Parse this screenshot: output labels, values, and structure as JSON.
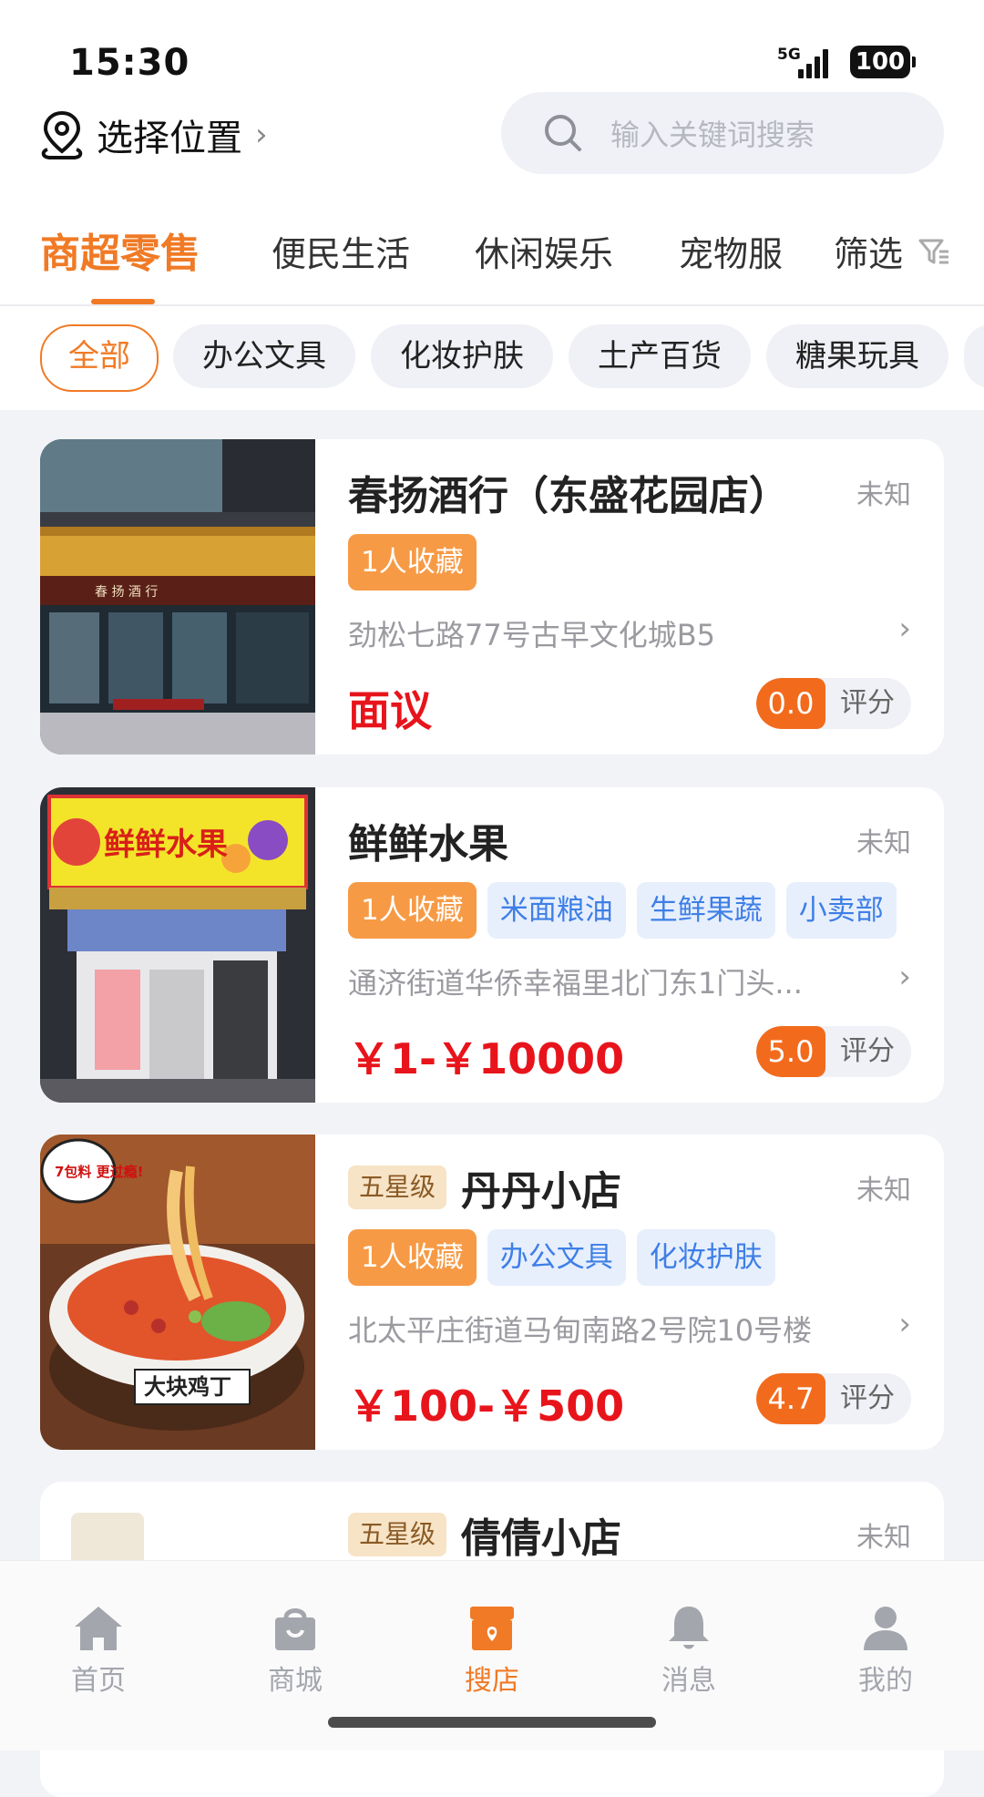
{
  "status_bar": {
    "time": "15:30",
    "network": "5G",
    "battery": "100"
  },
  "location": {
    "label": "选择位置"
  },
  "search": {
    "placeholder": "输入关键词搜索"
  },
  "tabs": [
    {
      "label": "商超零售",
      "active": true
    },
    {
      "label": "便民生活"
    },
    {
      "label": "休闲娱乐"
    },
    {
      "label": "宠物服"
    }
  ],
  "filter_label": "筛选",
  "chips": [
    {
      "label": "全部",
      "active": true
    },
    {
      "label": "办公文具"
    },
    {
      "label": "化妆护肤"
    },
    {
      "label": "土产百货"
    },
    {
      "label": "糖果玩具"
    }
  ],
  "stores": [
    {
      "name": "春扬酒行（东盛花园店）",
      "distance": "未知",
      "tags": [
        "1人收藏"
      ],
      "address": "劲松七路77号古早文化城B5",
      "price": "面议",
      "score": "0.0",
      "score_label": "评分",
      "image_sign": "春 扬 酒 行"
    },
    {
      "name": "鲜鲜水果",
      "distance": "未知",
      "tags": [
        "1人收藏",
        "米面粮油",
        "生鲜果蔬",
        "小卖部"
      ],
      "address": "通济街道华侨幸福里北门东1门头...",
      "price": "￥1-￥10000",
      "score": "5.0",
      "score_label": "评分",
      "image_sign": "鲜鲜水果"
    },
    {
      "name": "丹丹小店",
      "badge": "五星级",
      "distance": "未知",
      "tags": [
        "1人收藏",
        "办公文具",
        "化妆护肤"
      ],
      "address": "北太平庄街道马甸南路2号院10号楼",
      "price": "￥100-￥500",
      "score": "4.7",
      "score_label": "评分",
      "image_bubble": "7包料 更过瘾!",
      "image_caption": "大块鸡丁"
    },
    {
      "name": "倩倩小店",
      "badge": "五星级",
      "distance": "未知"
    }
  ],
  "bottom_nav": [
    {
      "label": "首页",
      "icon": "home-icon"
    },
    {
      "label": "商城",
      "icon": "shopping-bag-icon"
    },
    {
      "label": "搜店",
      "icon": "store-icon",
      "active": true
    },
    {
      "label": "消息",
      "icon": "bell-icon"
    },
    {
      "label": "我的",
      "icon": "user-icon"
    }
  ],
  "colors": {
    "accent": "#f07a25",
    "price": "#e8141b",
    "tag_blue": "#3e7fe6",
    "background": "#f2f3f7"
  }
}
